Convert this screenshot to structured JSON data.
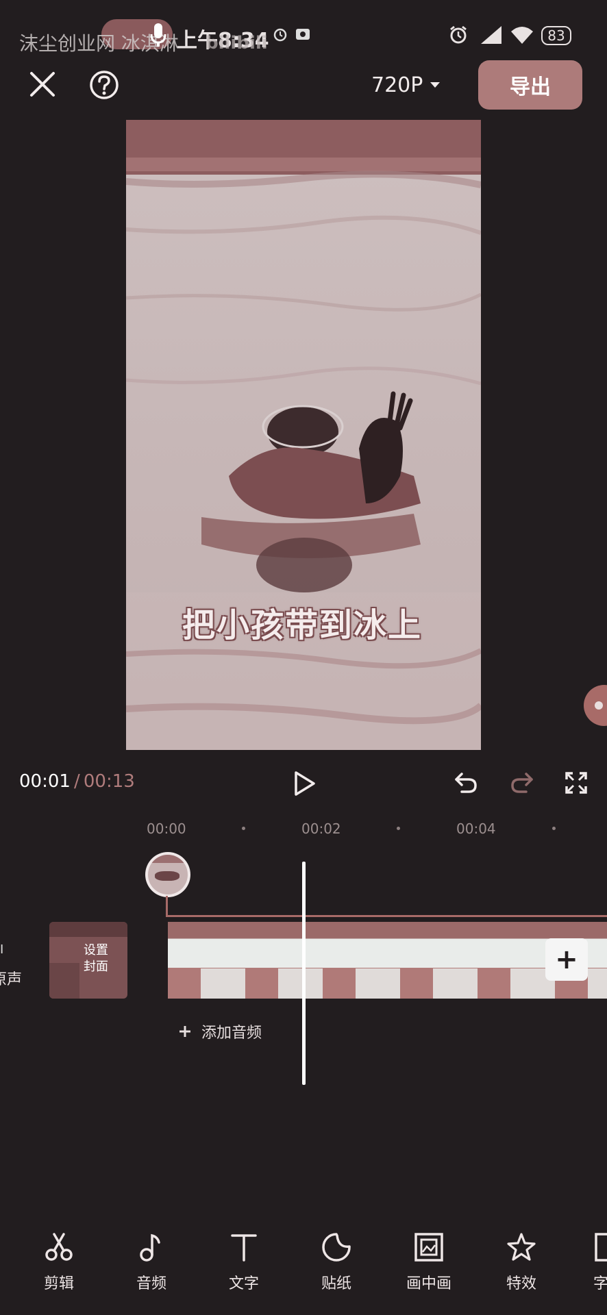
{
  "status_bar": {
    "watermark": "沫尘创业网 冰淇淋",
    "time": "上午8:34",
    "app_mark": "bilibili",
    "battery": "83"
  },
  "top_bar": {
    "resolution": "720P",
    "export_label": "导出"
  },
  "preview": {
    "subtitle": "把小孩带到冰上"
  },
  "playback": {
    "current_time": "00:01",
    "separator": "/",
    "total_time": "00:13"
  },
  "ruler": {
    "ticks": [
      "00:00",
      "00:02",
      "00:04"
    ]
  },
  "timeline": {
    "left_label_top": "I",
    "left_label": "原声",
    "cover_label_line1": "设置",
    "cover_label_line2": "封面",
    "add_clip": "+",
    "add_audio": "添加音频"
  },
  "toolbar": {
    "items": [
      {
        "label": "剪辑",
        "icon": "scissors-icon"
      },
      {
        "label": "音频",
        "icon": "music-note-icon"
      },
      {
        "label": "文字",
        "icon": "text-icon"
      },
      {
        "label": "贴纸",
        "icon": "sticker-icon"
      },
      {
        "label": "画中画",
        "icon": "picture-in-picture-icon"
      },
      {
        "label": "特效",
        "icon": "star-effect-icon"
      },
      {
        "label": "字",
        "icon": "caption-icon"
      }
    ]
  },
  "colors": {
    "background": "#221d1f",
    "accent": "#ad7b7a",
    "clip_tint": "#a86b68"
  }
}
